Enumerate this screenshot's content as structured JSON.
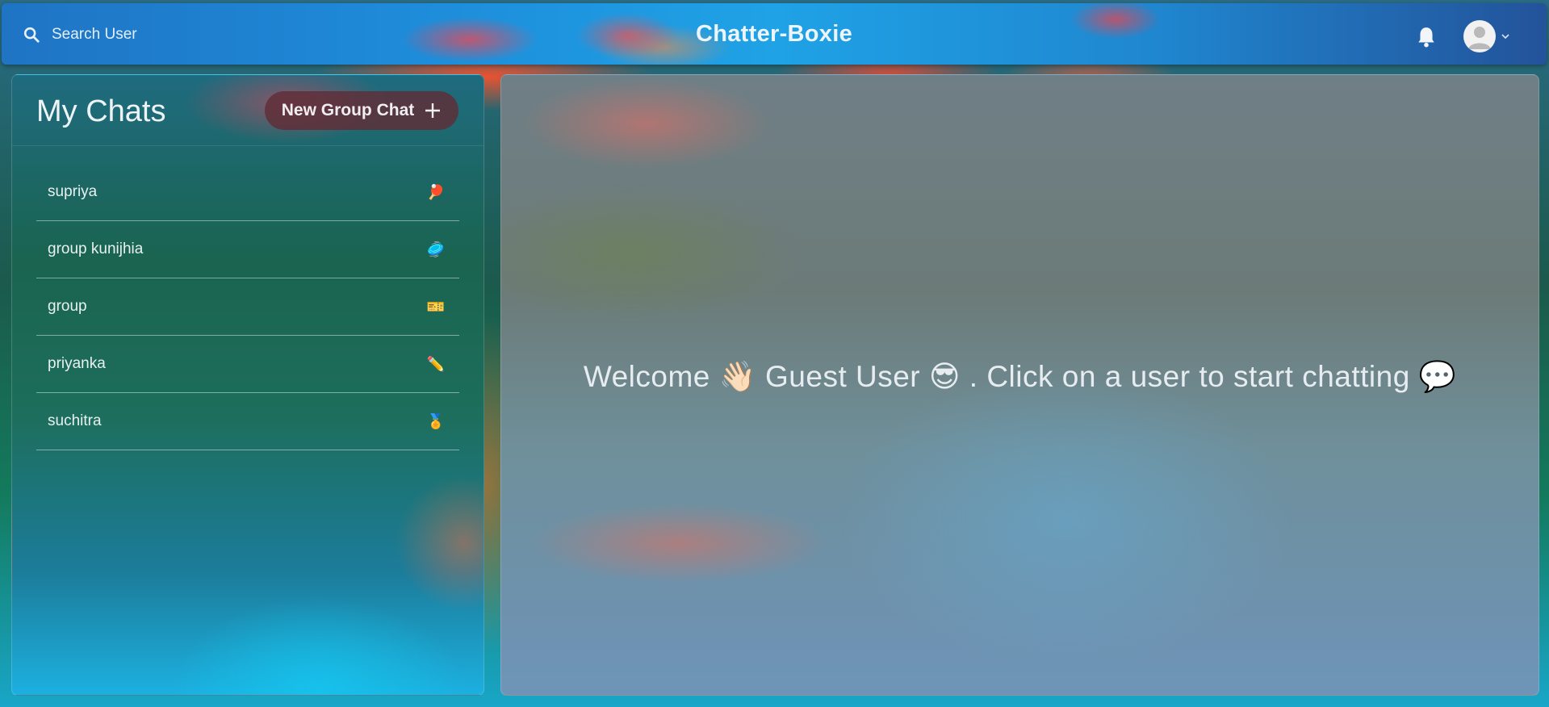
{
  "header": {
    "search_label": "Search User",
    "app_title": "Chatter-Boxie",
    "icons": [
      "search-icon",
      "bell-icon",
      "avatar-icon",
      "chevron-down-icon"
    ]
  },
  "sidebar": {
    "title": "My Chats",
    "new_group_label": "New Group Chat",
    "chats": [
      {
        "name": "supriya",
        "emoji": "🏓"
      },
      {
        "name": "group kunijhia",
        "emoji": "🥏"
      },
      {
        "name": "group",
        "emoji": "🎫"
      },
      {
        "name": "priyanka",
        "emoji": "✏️"
      },
      {
        "name": "suchitra",
        "emoji": "🏅"
      }
    ]
  },
  "main": {
    "welcome_prefix": "Welcome",
    "wave_emoji": "👋🏻",
    "user_name": "Guest User",
    "cool_emoji": "😎",
    "prompt": ". Click on a user to start chatting",
    "speech_emoji": "💬"
  }
}
